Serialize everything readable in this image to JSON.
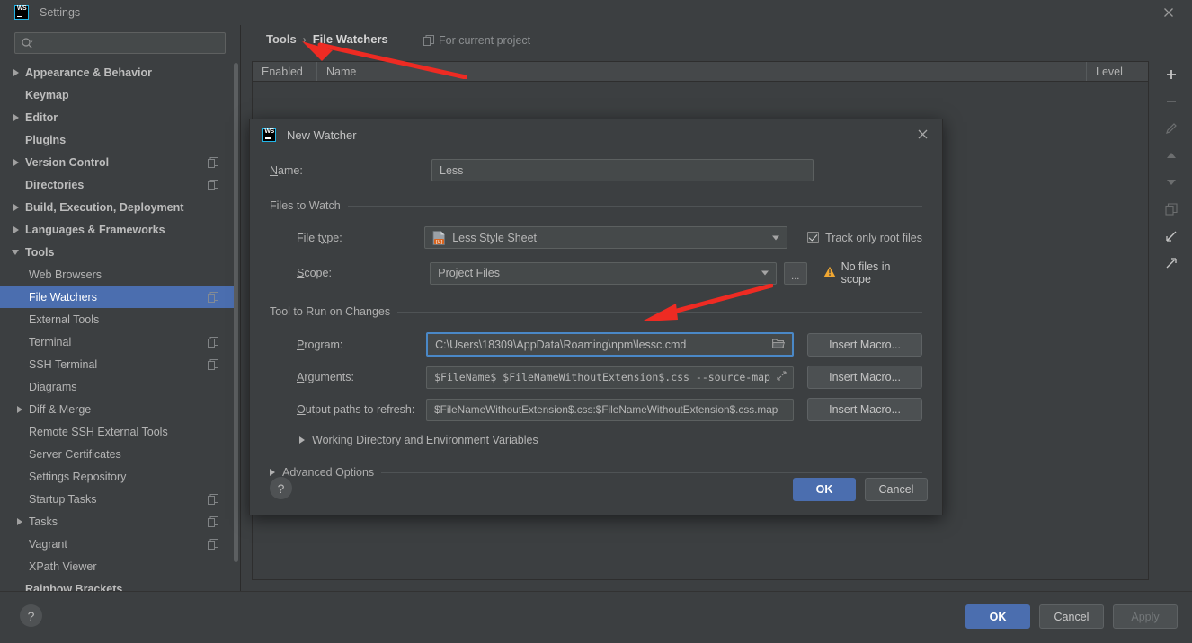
{
  "window": {
    "title": "Settings",
    "logo_text": "WS",
    "close_icon": "close-icon"
  },
  "sidebar": {
    "search": {
      "placeholder": "",
      "value": "",
      "icon": "search-icon"
    },
    "items": [
      {
        "label": "Appearance & Behavior",
        "arrow": "right",
        "level": 1,
        "bold": true,
        "badge": false,
        "selected": false
      },
      {
        "label": "Keymap",
        "arrow": "none",
        "level": 1,
        "bold": true,
        "badge": false,
        "selected": false
      },
      {
        "label": "Editor",
        "arrow": "right",
        "level": 1,
        "bold": true,
        "badge": false,
        "selected": false
      },
      {
        "label": "Plugins",
        "arrow": "none",
        "level": 1,
        "bold": true,
        "badge": false,
        "selected": false
      },
      {
        "label": "Version Control",
        "arrow": "right",
        "level": 1,
        "bold": true,
        "badge": true,
        "selected": false
      },
      {
        "label": "Directories",
        "arrow": "none",
        "level": 1,
        "bold": true,
        "badge": true,
        "selected": false
      },
      {
        "label": "Build, Execution, Deployment",
        "arrow": "right",
        "level": 1,
        "bold": true,
        "badge": false,
        "selected": false
      },
      {
        "label": "Languages & Frameworks",
        "arrow": "right",
        "level": 1,
        "bold": true,
        "badge": false,
        "selected": false
      },
      {
        "label": "Tools",
        "arrow": "down",
        "level": 1,
        "bold": true,
        "badge": false,
        "selected": false
      },
      {
        "label": "Web Browsers",
        "arrow": "none",
        "level": 2,
        "bold": false,
        "badge": false,
        "selected": false
      },
      {
        "label": "File Watchers",
        "arrow": "none",
        "level": 2,
        "bold": false,
        "badge": true,
        "selected": true
      },
      {
        "label": "External Tools",
        "arrow": "none",
        "level": 2,
        "bold": false,
        "badge": false,
        "selected": false
      },
      {
        "label": "Terminal",
        "arrow": "none",
        "level": 2,
        "bold": false,
        "badge": true,
        "selected": false
      },
      {
        "label": "SSH Terminal",
        "arrow": "none",
        "level": 2,
        "bold": false,
        "badge": true,
        "selected": false
      },
      {
        "label": "Diagrams",
        "arrow": "none",
        "level": 2,
        "bold": false,
        "badge": false,
        "selected": false
      },
      {
        "label": "Diff & Merge",
        "arrow": "right",
        "level": 2,
        "bold": false,
        "badge": false,
        "selected": false
      },
      {
        "label": "Remote SSH External Tools",
        "arrow": "none",
        "level": 2,
        "bold": false,
        "badge": false,
        "selected": false
      },
      {
        "label": "Server Certificates",
        "arrow": "none",
        "level": 2,
        "bold": false,
        "badge": false,
        "selected": false
      },
      {
        "label": "Settings Repository",
        "arrow": "none",
        "level": 2,
        "bold": false,
        "badge": false,
        "selected": false
      },
      {
        "label": "Startup Tasks",
        "arrow": "none",
        "level": 2,
        "bold": false,
        "badge": true,
        "selected": false
      },
      {
        "label": "Tasks",
        "arrow": "right",
        "level": 2,
        "bold": false,
        "badge": true,
        "selected": false
      },
      {
        "label": "Vagrant",
        "arrow": "none",
        "level": 2,
        "bold": false,
        "badge": true,
        "selected": false
      },
      {
        "label": "XPath Viewer",
        "arrow": "none",
        "level": 2,
        "bold": false,
        "badge": false,
        "selected": false
      },
      {
        "label": "Rainbow Brackets",
        "arrow": "none",
        "level": 1,
        "bold": true,
        "badge": false,
        "selected": false
      }
    ]
  },
  "main": {
    "breadcrumb": {
      "root": "Tools",
      "separator": "›",
      "leaf": "File Watchers"
    },
    "for_current_project": "For current project",
    "table": {
      "columns": [
        "Enabled",
        "Name",
        "Level"
      ],
      "rows": []
    },
    "toolbar": [
      {
        "name": "add-button",
        "glyph": "+",
        "disabled": false
      },
      {
        "name": "remove-button",
        "glyph": "−",
        "disabled": true
      },
      {
        "name": "edit-button",
        "glyph": "pencil",
        "disabled": true
      },
      {
        "name": "move-up-button",
        "glyph": "up",
        "disabled": true
      },
      {
        "name": "move-down-button",
        "glyph": "down",
        "disabled": true
      },
      {
        "name": "copy-button",
        "glyph": "copy",
        "disabled": true
      },
      {
        "name": "import-button",
        "glyph": "import",
        "disabled": false
      },
      {
        "name": "export-button",
        "glyph": "export",
        "disabled": false
      }
    ]
  },
  "footer": {
    "help_label": "?",
    "ok_label": "OK",
    "cancel_label": "Cancel",
    "apply_label": "Apply"
  },
  "dialog": {
    "title": "New Watcher",
    "logo_text": "WS",
    "name_label": {
      "pre": "",
      "mnemonic": "N",
      "post": "ame:"
    },
    "name_value": "Less",
    "files_to_watch_caption": "Files to Watch",
    "file_type_label": {
      "pre": "File t",
      "mnemonic": "y",
      "post": "pe:"
    },
    "file_type_value": "Less Style Sheet",
    "track_only_root_files": "Track only root files",
    "track_only_root_files_checked": true,
    "scope_label": {
      "pre": "",
      "mnemonic": "S",
      "post": "cope:"
    },
    "scope_value": "Project Files",
    "scope_browse_label": "...",
    "no_files_in_scope": "No files in scope",
    "tool_to_run_caption": "Tool to Run on Changes",
    "program_label": {
      "pre": "",
      "mnemonic": "P",
      "post": "rogram:"
    },
    "program_value": "C:\\Users\\18309\\AppData\\Roaming\\npm\\lessc.cmd",
    "arguments_label": {
      "pre": "",
      "mnemonic": "A",
      "post": "rguments:"
    },
    "arguments_value": "$FileName$ $FileNameWithoutExtension$.css --source-map",
    "output_paths_label": {
      "pre": "",
      "mnemonic": "O",
      "post": "utput paths to refresh:"
    },
    "output_paths_value": "$FileNameWithoutExtension$.css:$FileNameWithoutExtension$.css.map",
    "insert_macro_label": "Insert Macro...",
    "working_directory_label": "Working Directory and Environment Variables",
    "advanced_options_label": "Advanced Options",
    "help_label": "?",
    "ok_label": "OK",
    "cancel_label": "Cancel"
  },
  "colors": {
    "background": "#3c3f41",
    "accent": "#4b6eaf",
    "selection": "#4b6eaf",
    "focus_border": "#4a88c7",
    "warning": "#f0a732",
    "annotation_arrow": "#ee2b23",
    "logo_border": "#22b5e8"
  }
}
